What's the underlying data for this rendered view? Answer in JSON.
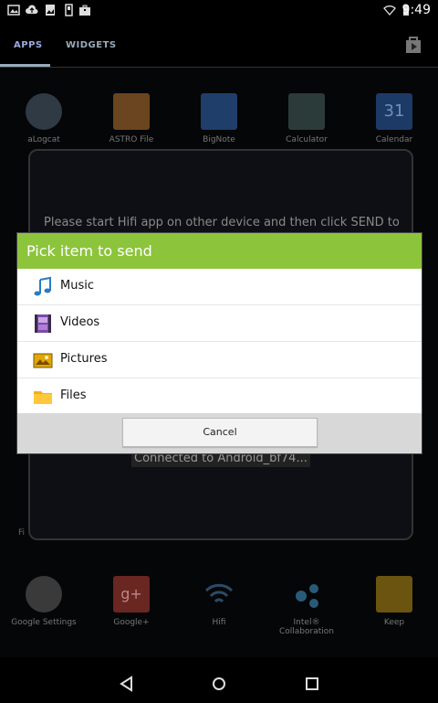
{
  "status_bar": {
    "time": "9:49"
  },
  "tabs": [
    {
      "label": "APPS"
    },
    {
      "label": "WIDGETS"
    }
  ],
  "apps_row1": [
    {
      "label": "aLogcat"
    },
    {
      "label": "ASTRO File"
    },
    {
      "label": "BigNote"
    },
    {
      "label": "Calculator"
    },
    {
      "label": "Calendar"
    }
  ],
  "apps_row2": [
    {
      "label": "Google Settings"
    },
    {
      "label": "Google+"
    },
    {
      "label": "Hifi"
    },
    {
      "label": "Intel® Collaboration"
    },
    {
      "label": "Keep"
    }
  ],
  "left_fragment": "Fi",
  "hifi": {
    "message": "Please start Hifi app on other device and then click SEND to",
    "connected": "Connected to Android_bf74..."
  },
  "picker": {
    "title": "Pick item to send",
    "items": [
      {
        "label": "Music",
        "icon": "music-note-icon"
      },
      {
        "label": "Videos",
        "icon": "film-icon"
      },
      {
        "label": "Pictures",
        "icon": "pictures-icon"
      },
      {
        "label": "Files",
        "icon": "folder-icon"
      }
    ],
    "cancel_label": "Cancel"
  },
  "colors": {
    "accent": "#8cc43c"
  }
}
